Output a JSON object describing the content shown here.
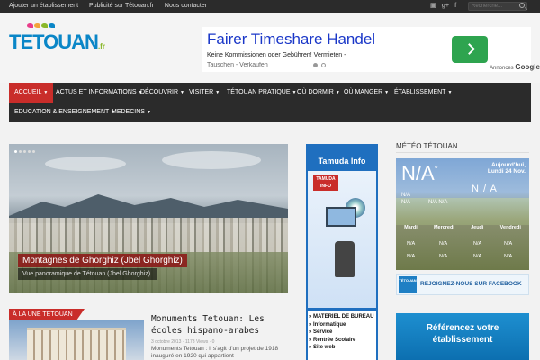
{
  "topbar": {
    "links": [
      "Ajouter un établissement",
      "Publicité sur Tétouan.fr",
      "Nous contacter"
    ],
    "social": [
      "rss-icon",
      "googleplus-icon",
      "facebook-icon"
    ],
    "social_glyphs": [
      "▣",
      "g+",
      "f"
    ],
    "search_placeholder": "Recherche..."
  },
  "logo": {
    "text": "TETOUAN",
    "suffix": ".fr",
    "bird_colors": [
      "#e83c8a",
      "#f2a33a",
      "#8ab82a",
      "#0a86c7"
    ]
  },
  "ad": {
    "title": "Fairer Timeshare Handel",
    "text": "Keine Kommissionen oder Gebühren! Vermieten -",
    "text2": "Tauschen - Verkaufen",
    "ads_by": "Annonces",
    "ads_brand": "Google"
  },
  "nav": {
    "row1": [
      {
        "label": "ACCUEIL",
        "active": true
      },
      {
        "label": "ACTUS ET INFORMATIONS",
        "active": false
      },
      {
        "label": "DÉCOUVRIR",
        "active": false
      },
      {
        "label": "VISITER",
        "active": false
      },
      {
        "label": "TÉTOUAN PRATIQUE",
        "active": false
      },
      {
        "label": "OÙ DORMIR",
        "active": false
      },
      {
        "label": "OÙ MANGER",
        "active": false
      },
      {
        "label": "ÉTABLISSEMENT",
        "active": false
      }
    ],
    "row2": [
      {
        "label": "EDUCATION & ENSEIGNEMENT"
      },
      {
        "label": "MEDECINS"
      }
    ],
    "accent": "#c92d2a"
  },
  "slider": {
    "caption": "Montagnes de Ghorghiz (Jbel Ghorghiz)",
    "subcaption": "Vue panoramique de Tétouan (Jbel Ghorghiz)."
  },
  "une": {
    "tag": "À LA UNE TÉTOUAN",
    "title": "Monuments Tetouan: Les écoles hispano-arabes",
    "date": "3 octobre 2013",
    "views": "1173 Views",
    "comments": "0",
    "excerpt": "Monuments Tetouan : il s'agit d'un projet de 1918 inauguré en 1920 qui appartient"
  },
  "tamuda": {
    "title": "Tamuda Info",
    "logo_text": "TAMUDA INFO",
    "items": [
      "MATERIEL DE BUREAU",
      "Informatique",
      "Service",
      "Rentrée Scolaire",
      "Site web"
    ]
  },
  "weather": {
    "title": "MÉTÉO TÉTOUAN",
    "big": "N/A",
    "degree": "°",
    "date_line1": "Aujourd'hui,",
    "date_line2": "Lundi 24 Nov.",
    "mid": "N / A",
    "small1": "N/A",
    "small2": "N/A",
    "small3": "N/A N/A",
    "days": [
      "Mardi",
      "Mercredi",
      "Jeudi",
      "Vendredi"
    ],
    "cell": "N/A"
  },
  "facebook": {
    "icon_text": "TÉTOUAN",
    "label": "REJOIGNEZ-NOUS SUR FACEBOOK"
  },
  "referencez": {
    "line1": "Référencez votre",
    "line2": "établissement"
  }
}
